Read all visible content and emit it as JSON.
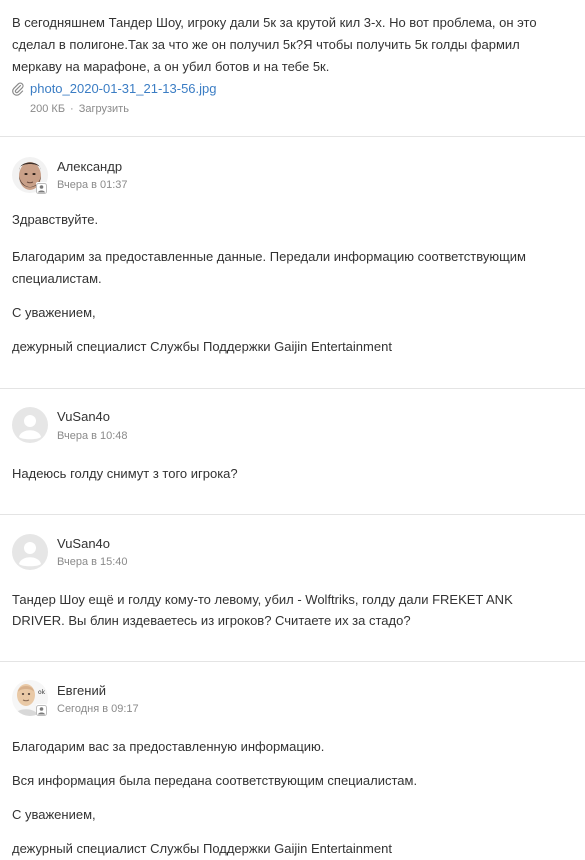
{
  "first_post": {
    "text_lines": [
      "В сегодняшнем Тандер Шоу, игроку дали 5к за крутой кил 3-х. Но вот проблема, он это",
      "сделал в полигоне.Так за что же он получил 5к?Я чтобы получить 5к голды фармил",
      "меркаву на марафоне, а он убил ботов и на тебе 5к."
    ],
    "attachment": {
      "icon": "paperclip-icon",
      "filename": "photo_2020-01-31_21-13-56.jpg",
      "size": "200 КБ",
      "separator": "·",
      "download_label": "Загрузить"
    }
  },
  "comments": [
    {
      "author": "Александр",
      "time": "Вчера в 01:37",
      "avatar": "photo-avatar-bearded-man",
      "badge": "staff-badge-icon",
      "paragraphs": [
        "Здравствуйте.",
        "Благодарим за предоставленные данные. Передали информацию соответствующим",
        "специалистам.",
        "С уважением,",
        "дежурный специалист Службы Поддержки Gaijin Entertainment"
      ]
    },
    {
      "author": "VuSan4o",
      "time": "Вчера в 10:48",
      "avatar": "default-user-icon",
      "paragraphs": [
        "Надеюсь голду снимут з того игрока?"
      ]
    },
    {
      "author": "VuSan4o",
      "time": "Вчера в 15:40",
      "avatar": "default-user-icon",
      "paragraphs": [
        "Тандер Шоу ещё и голду кому-то левому, убил - Wolftriks, голду дали FREKET ANK",
        "DRIVER. Вы блин издеваетесь из игроков? Считаете их за стадо?"
      ]
    },
    {
      "author": "Евгений",
      "time": "Сегодня в 09:17",
      "avatar": "photo-avatar-bald-man-ok",
      "avatar_caption": "ok",
      "badge": "staff-badge-icon",
      "paragraphs": [
        "Благодарим вас за предоставленную информацию.",
        "Вся информация была передана соответствующим специалистам.",
        "С уважением,",
        "дежурный специалист Службы Поддержки Gaijin Entertainment"
      ]
    }
  ],
  "colors": {
    "text": "#333333",
    "muted": "#8a8a8a",
    "link": "#3b7dc4",
    "divider": "#e4e4e4"
  }
}
